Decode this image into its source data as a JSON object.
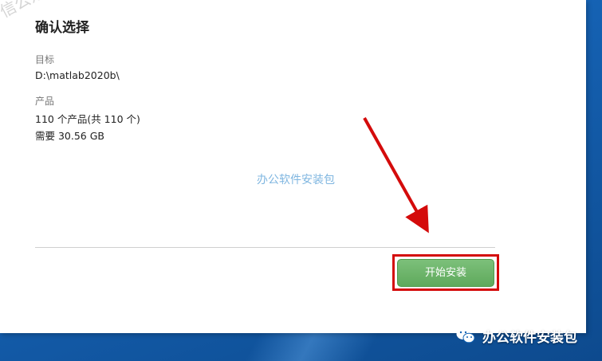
{
  "dialog": {
    "title": "确认选择",
    "target_label": "目标",
    "target_path": "D:\\matlab2020b\\",
    "product_label": "产品",
    "product_count": "110 个产品(共 110 个)",
    "required_space": "需要 30.56 GB",
    "install_button_label": "开始安装"
  },
  "watermarks": {
    "center": "办公软件安装包",
    "corner": "信公众号"
  },
  "brand": {
    "name": "办公软件安装包",
    "icon": "wechat-icon"
  },
  "colors": {
    "install_button": "#6cb469",
    "highlight_red": "#d40b0b",
    "watermark_blue": "#7fb6e0"
  }
}
